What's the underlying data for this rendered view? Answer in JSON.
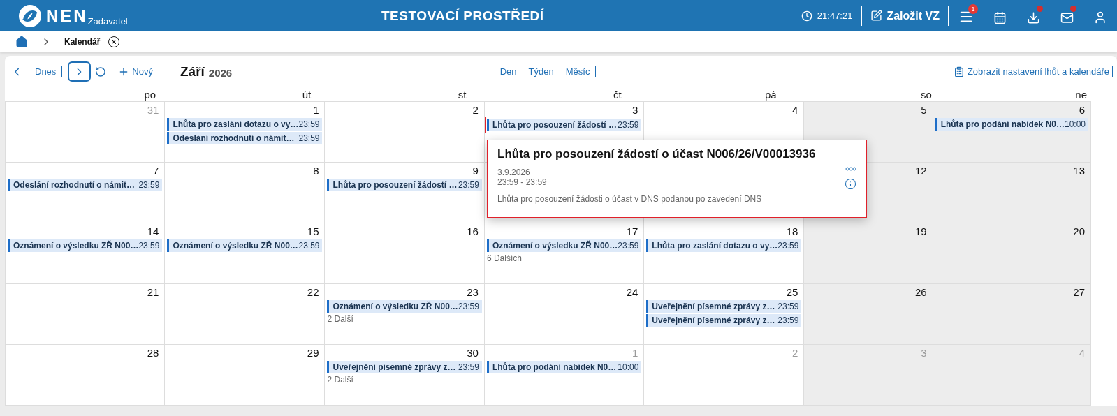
{
  "header": {
    "logo": "NEN",
    "logo_sub": "Zadavatel",
    "title": "TESTOVACÍ PROSTŘEDÍ",
    "clock": "21:47:21",
    "create_button": "Založit VZ",
    "menu_badge": "1"
  },
  "breadcrumb": {
    "current": "Kalendář"
  },
  "toolbar": {
    "today": "Dnes",
    "new": "Nový",
    "month": "Září",
    "year": "2026",
    "views": [
      {
        "label": "Den",
        "selected": false
      },
      {
        "label": "Týden",
        "selected": false
      },
      {
        "label": "Měsíc",
        "selected": false
      }
    ],
    "settings_link": "Zobrazit nastavení lhůt a kalendáře"
  },
  "weekdays": [
    "po",
    "út",
    "st",
    "čt",
    "pá",
    "so",
    "ne"
  ],
  "weeks": [
    [
      {
        "day": "31",
        "other_month": true,
        "weekend": false
      },
      {
        "day": "1",
        "other_month": false,
        "weekend": false,
        "events": [
          {
            "title": "Lhůta pro zaslání dotazu o vy…",
            "time": "23:59",
            "selected": false
          },
          {
            "title": "Odeslání rozhodnutí o námit…",
            "time": "23:59",
            "selected": false
          }
        ]
      },
      {
        "day": "2",
        "other_month": false,
        "weekend": false
      },
      {
        "day": "3",
        "other_month": false,
        "weekend": false,
        "events": [
          {
            "title": "Lhůta pro posouzení žádostí …",
            "time": "23:59",
            "selected": true
          }
        ]
      },
      {
        "day": "4",
        "other_month": false,
        "weekend": false
      },
      {
        "day": "5",
        "other_month": false,
        "weekend": true
      },
      {
        "day": "6",
        "other_month": false,
        "weekend": true,
        "events": [
          {
            "title": "Lhůta pro podání nabídek N0…",
            "time": "10:00",
            "selected": false
          }
        ]
      }
    ],
    [
      {
        "day": "7",
        "other_month": false,
        "weekend": false,
        "events": [
          {
            "title": "Odeslání rozhodnutí o námit…",
            "time": "23:59",
            "selected": false
          }
        ]
      },
      {
        "day": "8",
        "other_month": false,
        "weekend": false
      },
      {
        "day": "9",
        "other_month": false,
        "weekend": false,
        "events": [
          {
            "title": "Lhůta pro posouzení žádostí …",
            "time": "23:59",
            "selected": false
          }
        ]
      },
      {
        "weekend": false
      },
      {
        "weekend": false
      },
      {
        "day": "12",
        "other_month": false,
        "weekend": true
      },
      {
        "day": "13",
        "other_month": false,
        "weekend": true
      }
    ],
    [
      {
        "day": "14",
        "other_month": false,
        "weekend": false,
        "events": [
          {
            "title": "Oznámení o výsledku ZŘ N00…",
            "time": "23:59",
            "selected": false
          }
        ]
      },
      {
        "day": "15",
        "other_month": false,
        "weekend": false,
        "events": [
          {
            "title": "Oznámení o výsledku ZŘ N00…",
            "time": "23:59",
            "selected": false
          }
        ]
      },
      {
        "day": "16",
        "other_month": false,
        "weekend": false
      },
      {
        "day": "17",
        "other_month": false,
        "weekend": false,
        "events": [
          {
            "title": "Oznámení o výsledku ZŘ N00…",
            "time": "23:59",
            "selected": false
          }
        ],
        "more": "6 Dalších"
      },
      {
        "day": "18",
        "other_month": false,
        "weekend": false,
        "events": [
          {
            "title": "Lhůta pro zaslání dotazu o vy…",
            "time": "23:59",
            "selected": false
          }
        ]
      },
      {
        "day": "19",
        "other_month": false,
        "weekend": true
      },
      {
        "day": "20",
        "other_month": false,
        "weekend": true
      }
    ],
    [
      {
        "day": "21",
        "other_month": false,
        "weekend": false
      },
      {
        "day": "22",
        "other_month": false,
        "weekend": false
      },
      {
        "day": "23",
        "other_month": false,
        "weekend": false,
        "events": [
          {
            "title": "Oznámení o výsledku ZŘ N00…",
            "time": "23:59",
            "selected": false
          }
        ],
        "more": "2 Další"
      },
      {
        "day": "24",
        "other_month": false,
        "weekend": false
      },
      {
        "day": "25",
        "other_month": false,
        "weekend": false,
        "events": [
          {
            "title": "Uveřejnění písemné zprávy z…",
            "time": "23:59",
            "selected": false
          },
          {
            "title": "Uveřejnění písemné zprávy z…",
            "time": "23:59",
            "selected": false
          }
        ]
      },
      {
        "day": "26",
        "other_month": false,
        "weekend": true
      },
      {
        "day": "27",
        "other_month": false,
        "weekend": true
      }
    ],
    [
      {
        "day": "28",
        "other_month": false,
        "weekend": false
      },
      {
        "day": "29",
        "other_month": false,
        "weekend": false
      },
      {
        "day": "30",
        "other_month": false,
        "weekend": false,
        "events": [
          {
            "title": "Uveřejnění písemné zprávy z…",
            "time": "23:59",
            "selected": false
          }
        ],
        "more": "2 Další"
      },
      {
        "day": "1",
        "other_month": true,
        "weekend": false,
        "events": [
          {
            "title": "Lhůta pro podání nabídek N0…",
            "time": "10:00",
            "selected": false
          }
        ]
      },
      {
        "day": "2",
        "other_month": true,
        "weekend": false
      },
      {
        "day": "3",
        "other_month": true,
        "weekend": true
      },
      {
        "day": "4",
        "other_month": true,
        "weekend": true
      }
    ]
  ],
  "popup": {
    "title": "Lhůta pro posouzení žádostí o účast N006/26/V00013936",
    "date": "3.9.2026",
    "time_range": "23:59 - 23:59",
    "description": "Lhůta pro posouzení žádosti o účast v DNS podanou po zavedení DNS"
  }
}
